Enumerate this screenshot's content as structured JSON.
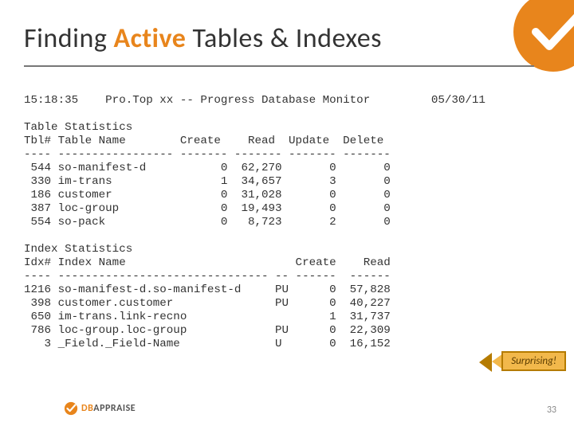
{
  "title_parts": {
    "a": "Finding ",
    "b": "Active",
    "c": " Tables & Indexes"
  },
  "header_line": "15:18:35    Pro.Top xx -- Progress Database Monitor         05/30/11",
  "table_section": {
    "heading": "Table Statistics",
    "header": "Tbl# Table Name        Create    Read  Update  Delete",
    "divider": "---- ----------------- ------- ------- ------- -------",
    "rows": [
      " 544 so-manifest-d           0  62,270       0       0",
      " 330 im-trans                1  34,657       3       0",
      " 186 customer                0  31,028       0       0",
      " 387 loc-group               0  19,493       0       0",
      " 554 so-pack                 0   8,723       2       0"
    ]
  },
  "index_section": {
    "heading": "Index Statistics",
    "header": "Idx# Index Name                         Create    Read",
    "divider": "---- ------------------------------- -- ------  ------",
    "rows": [
      "1216 so-manifest-d.so-manifest-d     PU      0  57,828",
      " 398 customer.customer               PU      0  40,227",
      " 650 im-trans.link-recno                     1  31,737",
      " 786 loc-group.loc-group             PU      0  22,309",
      "   3 _Field._Field-Name              U       0  16,152"
    ]
  },
  "callout": "Surprising!",
  "page": "33",
  "footer": {
    "db": "DB",
    "app": "APPRAISE"
  }
}
